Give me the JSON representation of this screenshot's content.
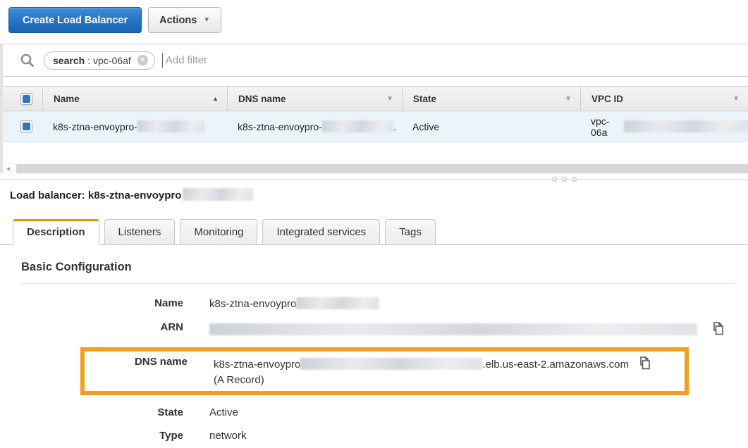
{
  "toolbar": {
    "create_label": "Create Load Balancer",
    "actions_label": "Actions"
  },
  "filter": {
    "tag_key": "search",
    "tag_separator": ":",
    "tag_value": "vpc-06af",
    "placeholder": "Add filter"
  },
  "table": {
    "columns": [
      {
        "label": "Name",
        "sorted": "asc"
      },
      {
        "label": "DNS name"
      },
      {
        "label": "State"
      },
      {
        "label": "VPC ID"
      }
    ],
    "row": {
      "selected": true,
      "name_prefix": "k8s-ztna-envoypro-",
      "dns_prefix": "k8s-ztna-envoypro-",
      "dns_tail": ".",
      "state": "Active",
      "vpc_prefix": "vpc-06a"
    }
  },
  "detail": {
    "heading": "Load balancer: k8s-ztna-envoypro",
    "tabs": [
      {
        "label": "Description",
        "active": true
      },
      {
        "label": "Listeners"
      },
      {
        "label": "Monitoring"
      },
      {
        "label": "Integrated services"
      },
      {
        "label": "Tags"
      }
    ],
    "section_title": "Basic Configuration",
    "fields": {
      "name_label": "Name",
      "name_value_prefix": "k8s-ztna-envoypro",
      "arn_label": "ARN",
      "dns_label": "DNS name",
      "dns_value_prefix": "k8s-ztna-envoypro",
      "dns_value_suffix": ".elb.us-east-2.amazonaws.com",
      "dns_secondary": "(A Record)",
      "state_label": "State",
      "state_value": "Active",
      "type_label": "Type",
      "type_value": "network"
    }
  },
  "icons": {
    "sort_asc": "▲",
    "column_dropdown": "▼",
    "actions_chevron": "▼",
    "scroll_left_arrow": "◄",
    "filter_remove": "×"
  },
  "colors": {
    "primary_button": "#2373c2",
    "highlight_border": "#efa11e",
    "active_tab_accent": "#e78f08",
    "selected_row_bg": "#ebf3fb",
    "checkbox_blue": "#2e77bc"
  }
}
